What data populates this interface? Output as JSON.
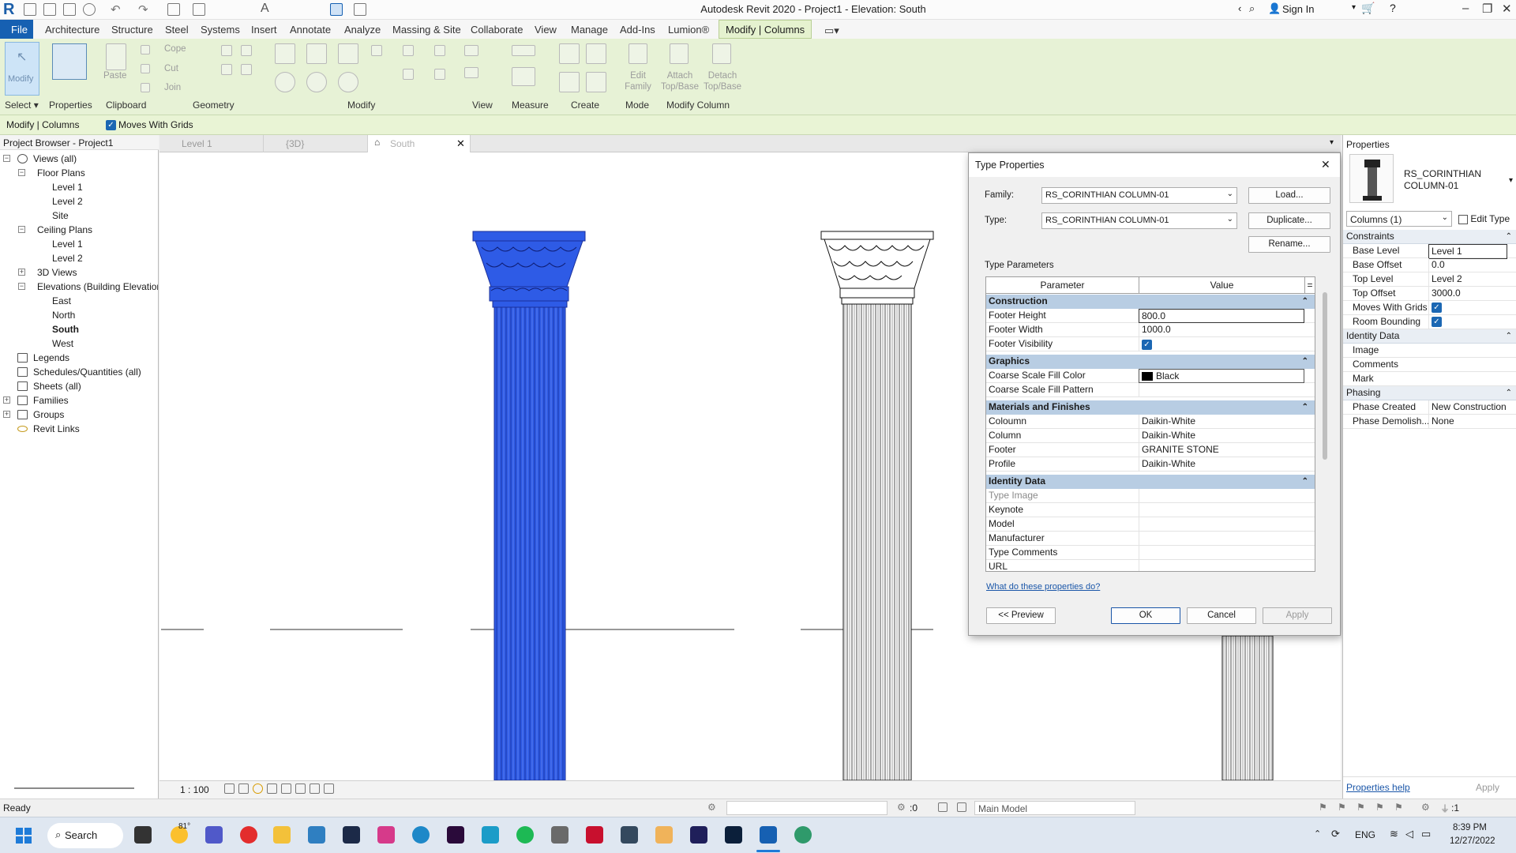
{
  "titlebar": {
    "title": "Autodesk Revit 2020 - Project1 - Elevation: South",
    "sign_in": "Sign In"
  },
  "menu": {
    "file": "File",
    "items": [
      "Architecture",
      "Structure",
      "Steel",
      "Systems",
      "Insert",
      "Annotate",
      "Analyze",
      "Massing & Site",
      "Collaborate",
      "View",
      "Manage",
      "Add-Ins",
      "Lumion®"
    ],
    "context_tab": "Modify | Columns"
  },
  "ribbon": {
    "modify": "Modify",
    "paste": "Paste",
    "cope": "Cope",
    "cut": "Cut",
    "join": "Join",
    "edit_family": "Edit\nFamily",
    "attach": "Attach\nTop/Base",
    "detach": "Detach\nTop/Base",
    "panels": {
      "select": "Select",
      "properties": "Properties",
      "clipboard": "Clipboard",
      "geometry": "Geometry",
      "modify": "Modify",
      "view": "View",
      "measure": "Measure",
      "create": "Create",
      "mode": "Mode",
      "modify_column": "Modify Column"
    }
  },
  "options_bar": {
    "context": "Modify | Columns",
    "moves_with_grids": "Moves With Grids"
  },
  "project_browser": {
    "title": "Project Browser - Project1",
    "views_all": "Views (all)",
    "floor_plans": "Floor Plans",
    "fp_items": [
      "Level 1",
      "Level 2",
      "Site"
    ],
    "ceiling_plans": "Ceiling Plans",
    "cp_items": [
      "Level 1",
      "Level 2"
    ],
    "views_3d": "3D Views",
    "elevations": "Elevations (Building Elevation)",
    "elev_items": [
      "East",
      "North",
      "South",
      "West"
    ],
    "legends": "Legends",
    "schedules": "Schedules/Quantities (all)",
    "sheets": "Sheets (all)",
    "families": "Families",
    "groups": "Groups",
    "revit_links": "Revit Links"
  },
  "view_tabs": [
    "Level 1",
    "{3D}",
    "South"
  ],
  "view_control": {
    "scale": "1 : 100"
  },
  "dialog": {
    "title": "Type Properties",
    "family_label": "Family:",
    "family_value": "RS_CORINTHIAN COLUMN-01",
    "type_label": "Type:",
    "type_value": "RS_CORINTHIAN COLUMN-01",
    "load": "Load...",
    "duplicate": "Duplicate...",
    "rename": "Rename...",
    "type_parameters": "Type Parameters",
    "col_parameter": "Parameter",
    "col_value": "Value",
    "sections": {
      "construction": "Construction",
      "graphics": "Graphics",
      "materials": "Materials and Finishes",
      "identity": "Identity Data"
    },
    "construction_rows": [
      {
        "p": "Footer Height",
        "v": "800.0"
      },
      {
        "p": "Footer Width",
        "v": "1000.0"
      },
      {
        "p": "Footer Visibility",
        "v": ""
      }
    ],
    "graphics_rows": [
      {
        "p": "Coarse Scale Fill Color",
        "v": "Black"
      },
      {
        "p": "Coarse Scale Fill Pattern",
        "v": ""
      }
    ],
    "material_rows": [
      {
        "p": "Coloumn",
        "v": "Daikin-White"
      },
      {
        "p": "Column",
        "v": "Daikin-White"
      },
      {
        "p": "Footer",
        "v": "GRANITE STONE"
      },
      {
        "p": "Profile",
        "v": "Daikin-White"
      }
    ],
    "identity_rows": [
      {
        "p": "Type Image",
        "v": ""
      },
      {
        "p": "Keynote",
        "v": ""
      },
      {
        "p": "Model",
        "v": ""
      },
      {
        "p": "Manufacturer",
        "v": ""
      },
      {
        "p": "Type Comments",
        "v": ""
      },
      {
        "p": "URL",
        "v": ""
      }
    ],
    "help_link": "What do these properties do?",
    "preview": "<< Preview",
    "ok": "OK",
    "cancel": "Cancel",
    "apply": "Apply"
  },
  "properties": {
    "title": "Properties",
    "type_name": "RS_CORINTHIAN COLUMN-01",
    "selector": "Columns (1)",
    "edit_type": "Edit Type",
    "constraints": "Constraints",
    "constraint_rows": [
      {
        "p": "Base Level",
        "v": "Level 1"
      },
      {
        "p": "Base Offset",
        "v": "0.0"
      },
      {
        "p": "Top Level",
        "v": "Level 2"
      },
      {
        "p": "Top Offset",
        "v": "3000.0"
      },
      {
        "p": "Moves With Grids",
        "v": ""
      },
      {
        "p": "Room Bounding",
        "v": ""
      }
    ],
    "identity_data": "Identity Data",
    "identity_rows": [
      {
        "p": "Image",
        "v": ""
      },
      {
        "p": "Comments",
        "v": ""
      },
      {
        "p": "Mark",
        "v": ""
      }
    ],
    "phasing": "Phasing",
    "phasing_rows": [
      {
        "p": "Phase Created",
        "v": "New Construction"
      },
      {
        "p": "Phase Demolish...",
        "v": "None"
      }
    ],
    "help": "Properties help",
    "apply": "Apply"
  },
  "statusbar": {
    "status": "Ready",
    "zero": ":0",
    "model": "Main Model",
    "filter_count": ":1"
  },
  "taskbar": {
    "search": "Search",
    "temp": "81°",
    "lang": "ENG",
    "time": "8:39 PM",
    "date": "12/27/2022"
  },
  "colors": {
    "accent": "#1660b2",
    "selection": "#2e5be6",
    "ribbon": "#e7f2d6",
    "section_header": "#b8cde3"
  }
}
